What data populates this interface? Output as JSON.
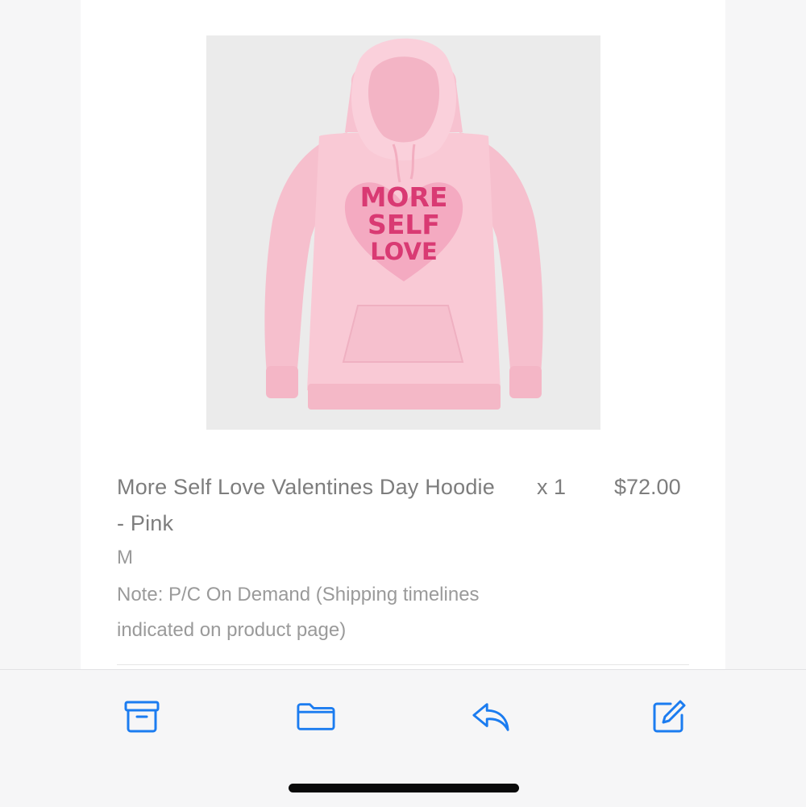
{
  "item": {
    "title": "More Self Love Valentines Day Hoodie - Pink",
    "quantity": "x 1",
    "price": "$72.00",
    "variant": "M",
    "note": "Note: P/C On Demand (Shipping timelines indicated on product page)",
    "print_text": [
      "MORE",
      "SELF",
      "LOVE"
    ]
  },
  "toolbar": {
    "icons": [
      "archive-icon",
      "folder-icon",
      "reply-icon",
      "compose-icon"
    ]
  },
  "colors": {
    "accent": "#1b7cf0",
    "hoodie": "#f8c6d3",
    "print": "#d93a73",
    "text": "#7d7d7d"
  }
}
